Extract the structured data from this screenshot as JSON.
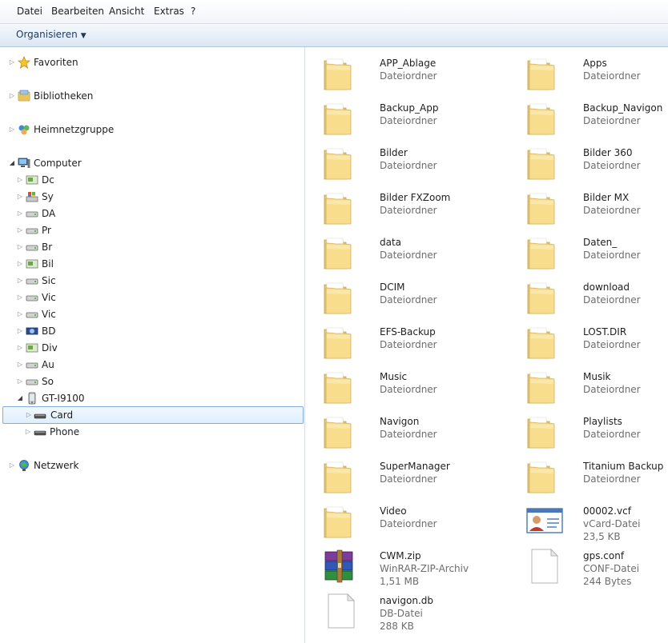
{
  "menubar": [
    "Datei",
    "Bearbeiten",
    "Ansicht",
    "Extras",
    "?"
  ],
  "commandbar": {
    "organize_label": "Organisieren"
  },
  "nav": {
    "favorites": "Favoriten",
    "libraries": "Bibliotheken",
    "homegroup": "Heimnetzgruppe",
    "computer": "Computer",
    "drives": [
      "Dc",
      "Sy",
      "DA",
      "Pr",
      "Br",
      "Bil",
      "Sic",
      "Vic",
      "Vic",
      "BD",
      "Div",
      "Au",
      "So"
    ],
    "device": "GT-I9100",
    "card": "Card",
    "phone": "Phone",
    "network": "Netzwerk"
  },
  "items": [
    {
      "name": "APP_Ablage",
      "type": "Dateiordner",
      "icon": "folder-icon"
    },
    {
      "name": "Apps",
      "type": "Dateiordner",
      "icon": "folder-icon"
    },
    {
      "name": "Backup_App",
      "type": "Dateiordner",
      "icon": "folder-icon"
    },
    {
      "name": "Backup_Navigon",
      "type": "Dateiordner",
      "icon": "folder-icon"
    },
    {
      "name": "Bilder",
      "type": "Dateiordner",
      "icon": "folder-icon"
    },
    {
      "name": "Bilder 360",
      "type": "Dateiordner",
      "icon": "folder-icon"
    },
    {
      "name": "Bilder FXZoom",
      "type": "Dateiordner",
      "icon": "folder-icon"
    },
    {
      "name": "Bilder MX",
      "type": "Dateiordner",
      "icon": "folder-icon"
    },
    {
      "name": "data",
      "type": "Dateiordner",
      "icon": "folder-icon"
    },
    {
      "name": "Daten_",
      "type": "Dateiordner",
      "icon": "folder-icon"
    },
    {
      "name": "DCIM",
      "type": "Dateiordner",
      "icon": "folder-icon"
    },
    {
      "name": "download",
      "type": "Dateiordner",
      "icon": "folder-icon"
    },
    {
      "name": "EFS-Backup",
      "type": "Dateiordner",
      "icon": "folder-icon"
    },
    {
      "name": "LOST.DIR",
      "type": "Dateiordner",
      "icon": "folder-icon"
    },
    {
      "name": "Music",
      "type": "Dateiordner",
      "icon": "folder-icon"
    },
    {
      "name": "Musik",
      "type": "Dateiordner",
      "icon": "folder-icon"
    },
    {
      "name": "Navigon",
      "type": "Dateiordner",
      "icon": "folder-icon"
    },
    {
      "name": "Playlists",
      "type": "Dateiordner",
      "icon": "folder-icon"
    },
    {
      "name": "SuperManager",
      "type": "Dateiordner",
      "icon": "folder-icon"
    },
    {
      "name": "Titanium Backup",
      "type": "Dateiordner",
      "icon": "folder-icon"
    },
    {
      "name": "Video",
      "type": "Dateiordner",
      "icon": "folder-icon"
    },
    {
      "name": "00002.vcf",
      "type": "vCard-Datei",
      "size": "23,5 KB",
      "icon": "vcard-icon"
    },
    {
      "name": "CWM.zip",
      "type": "WinRAR-ZIP-Archiv",
      "size": "1,51 MB",
      "icon": "winrar-icon"
    },
    {
      "name": "gps.conf",
      "type": "CONF-Datei",
      "size": "244 Bytes",
      "icon": "file-icon"
    },
    {
      "name": "navigon.db",
      "type": "DB-Datei",
      "size": "288 KB",
      "icon": "file-icon"
    }
  ]
}
